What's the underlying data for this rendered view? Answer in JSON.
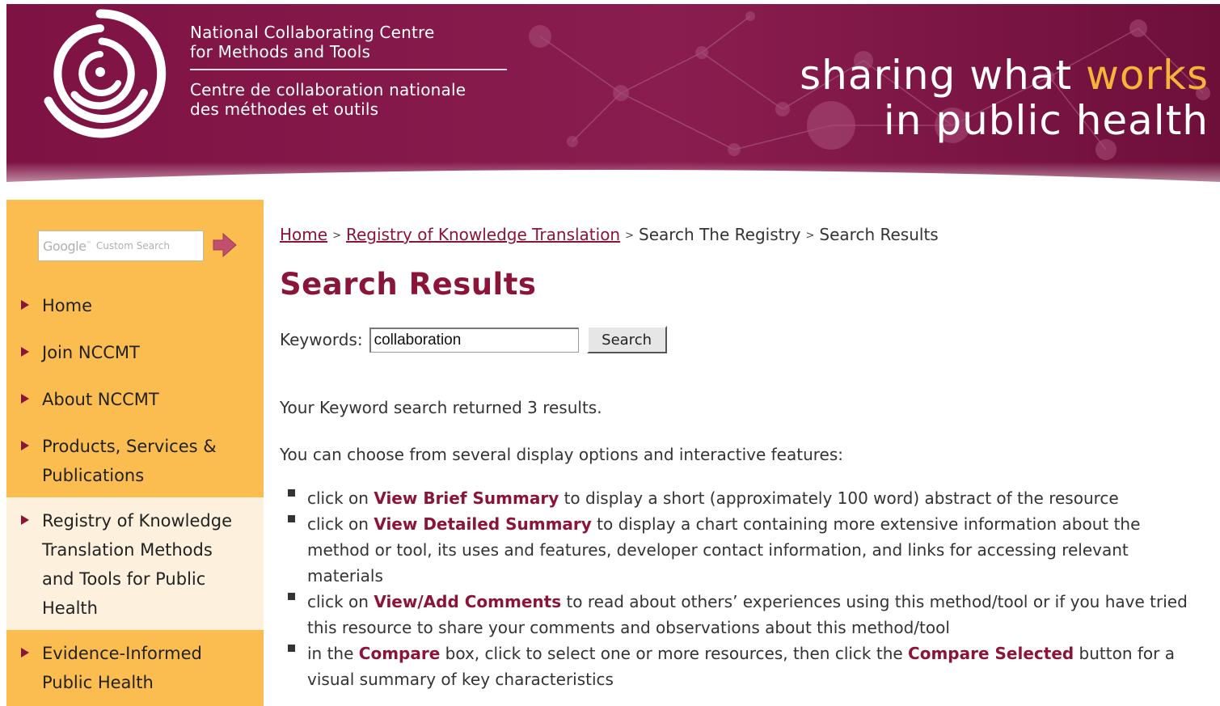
{
  "colors": {
    "brand": "#8b1538",
    "accent": "#f4b33a",
    "sidebar": "#fbbd4f",
    "sidebar_active": "#fdf0dc"
  },
  "header": {
    "org_name_en": [
      "National Collaborating Centre",
      "for Methods and Tools"
    ],
    "org_name_fr": [
      "Centre de collaboration nationale",
      "des méthodes et outils"
    ],
    "tagline_line1_pre": "sharing what ",
    "tagline_line1_accent": "works",
    "tagline_line2": "in public health",
    "logo_icon": "nccmt-swirl-logo"
  },
  "sidebar": {
    "search": {
      "google_mark": "Google",
      "tm": "™",
      "placeholder": "Custom Search",
      "go_icon": "arrow-right-icon"
    },
    "items": [
      {
        "lines": [
          "Home"
        ]
      },
      {
        "lines": [
          "Join NCCMT"
        ]
      },
      {
        "lines": [
          "About NCCMT"
        ]
      },
      {
        "lines": [
          "Products, Services &",
          "Publications"
        ]
      },
      {
        "lines": [
          "Registry of Knowledge",
          "Translation Methods",
          "and Tools for Public",
          "Health"
        ],
        "active": true
      },
      {
        "lines": [
          "Evidence-Informed",
          "Public Health"
        ]
      }
    ]
  },
  "main": {
    "breadcrumb": {
      "home": "Home",
      "registry": "Registry of Knowledge Translation",
      "search": "Search The Registry",
      "current": "Search Results",
      "sep": ">"
    },
    "title": "Search Results",
    "keywords_label": "Keywords:",
    "keywords_value": "collaboration",
    "search_button": "Search",
    "result_count": "Your Keyword search returned 3 results.",
    "options_intro": "You can choose from several display options and interactive features:",
    "options": [
      {
        "pre": "click on ",
        "kw": "View Brief Summary",
        "post": " to display a short (approximately 100 word) abstract of the resource"
      },
      {
        "pre": "click on ",
        "kw": "View Detailed Summary",
        "post": " to display a chart containing more extensive information about the method or tool, its uses and features, developer contact information, and links for accessing relevant materials"
      },
      {
        "pre": "click on ",
        "kw": "View/Add Comments",
        "post": " to read about others’ experiences using this method/tool or if you have tried this resource to share your comments and observations about this method/tool"
      },
      {
        "pre": "in the ",
        "kw": "Compare",
        "mid": " box, click to select one or more resources, then click the ",
        "kw2": "Compare Selected",
        "post": " button for a visual summary of key characteristics"
      }
    ]
  }
}
